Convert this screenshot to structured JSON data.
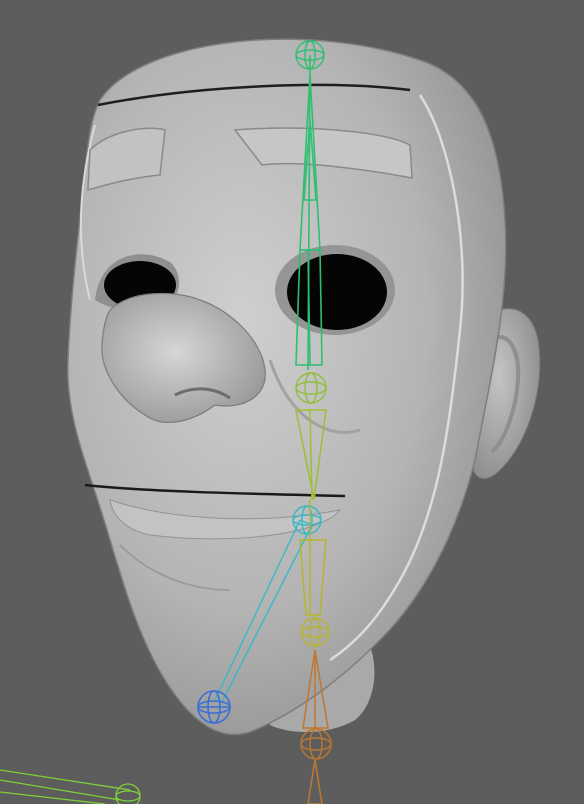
{
  "scene": {
    "kind": "3d-viewport",
    "background_color": "#5d5d5d",
    "model": "stylized-head-mesh",
    "mesh_color": "#b8b8b8",
    "rig": {
      "bone_colors": {
        "upper_spine": "#2fbf71",
        "mid_spine": "#b7b52a",
        "jaw": "#35b9c8",
        "lower": "#c0782e",
        "helper": "#7fcf3a"
      },
      "joint_count": 6
    }
  }
}
